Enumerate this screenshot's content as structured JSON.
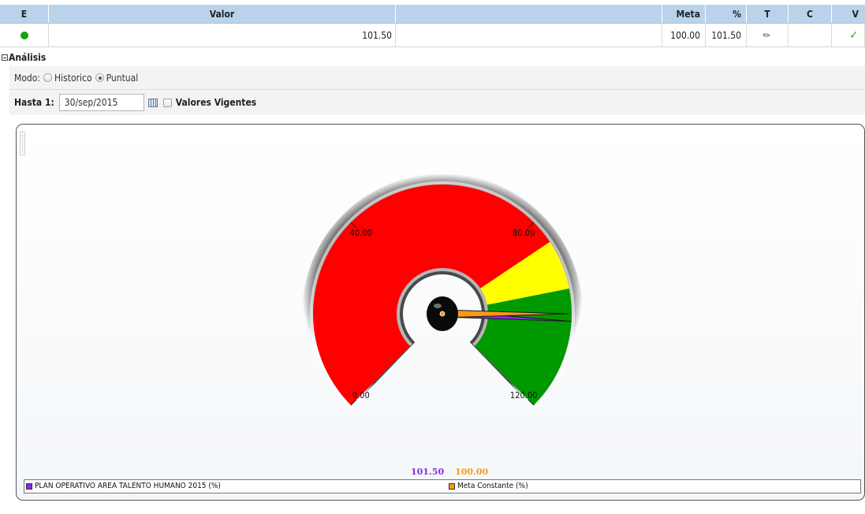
{
  "grid": {
    "headers": {
      "e": "E",
      "valor": "Valor",
      "meta": "Meta",
      "pct": "%",
      "t": "T",
      "c": "C",
      "v": "V"
    },
    "row": {
      "valor": "101.50",
      "meta": "100.00",
      "pct": "101.50",
      "c": "",
      "v_mark": "✓",
      "t_mark": "✎",
      "status_color": "#12a112"
    }
  },
  "analysis": {
    "title": "Análisis",
    "modo_label": "Modo:",
    "modo_options": [
      "Historico",
      "Puntual"
    ],
    "modo_selected": "Puntual",
    "hasta_label": "Hasta 1:",
    "hasta_value": "30/sep/2015",
    "vigentes_label": "Valores Vigentes",
    "vigentes_checked": false
  },
  "chart_data": {
    "type": "gauge",
    "min": 0,
    "max": 120,
    "ticks": [
      "0.00",
      "40.00",
      "80.00",
      "120.00"
    ],
    "bands": [
      {
        "from": 0,
        "to": 85,
        "color": "#ff0000"
      },
      {
        "from": 85,
        "to": 95,
        "color": "#ffff00"
      },
      {
        "from": 95,
        "to": 120,
        "color": "#009900"
      }
    ],
    "series": [
      {
        "name": "PLAN OPERATIVO AREA TALENTO HUMANO 2015 (%)",
        "value": 101.5,
        "color": "#8b2be2",
        "readout": "101.50"
      },
      {
        "name": "Meta Constante (%)",
        "value": 100.0,
        "color": "#f79a14",
        "readout": "100.00"
      }
    ]
  }
}
